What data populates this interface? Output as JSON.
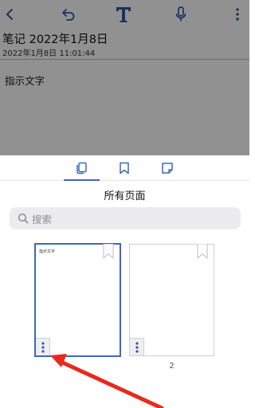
{
  "editor": {
    "title": "笔记 2022年1月8日",
    "datetime": "2022年1月8日 11:01:44",
    "body_text": "指示文字",
    "toolbar_icons": [
      "chevron-left-icon",
      "undo-icon",
      "text-format-icon",
      "microphone-icon",
      "more-vertical-icon"
    ]
  },
  "sheet": {
    "tabs": [
      "pages-icon",
      "bookmark-icon",
      "sticky-note-icon"
    ],
    "active_tab": "pages-icon",
    "title": "所有页面",
    "search": {
      "placeholder": "搜索"
    },
    "pages": [
      {
        "thumb_text": "指示文字",
        "number": "",
        "selected": true
      },
      {
        "thumb_text": "",
        "number": "2",
        "selected": false
      }
    ]
  },
  "colors": {
    "accent": "#3d68b8",
    "arrow": "#e8291e",
    "overlay": "rgba(0,0,0,0.43)"
  }
}
